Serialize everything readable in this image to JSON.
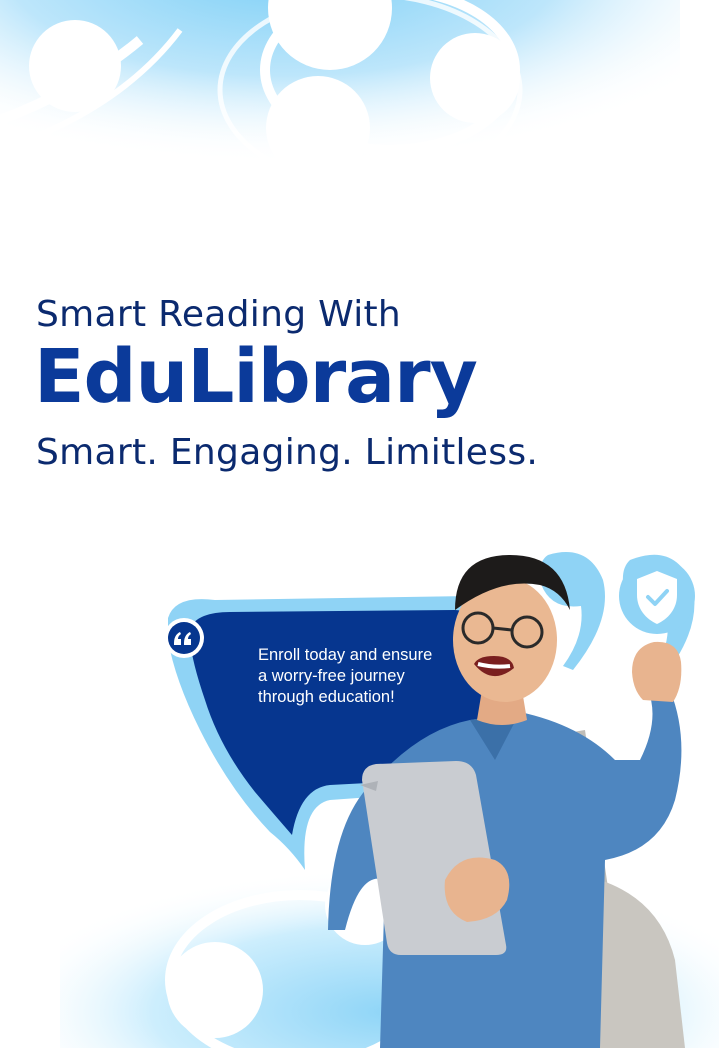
{
  "headline": "Smart Reading With",
  "brand": "EduLibrary",
  "tagline": "Smart. Engaging. Limitless.",
  "bubble": {
    "text": "Enroll today and ensure a worry-free journey through education!"
  },
  "icons": {
    "quote": "quote-icon",
    "shield": "shield-check-icon"
  },
  "colors": {
    "navy": "#0b2a6f",
    "brand_blue": "#0b3a9a",
    "bubble": "#06368f",
    "light_blue": "#8fd3f5",
    "pale_blue": "#d6efff"
  }
}
